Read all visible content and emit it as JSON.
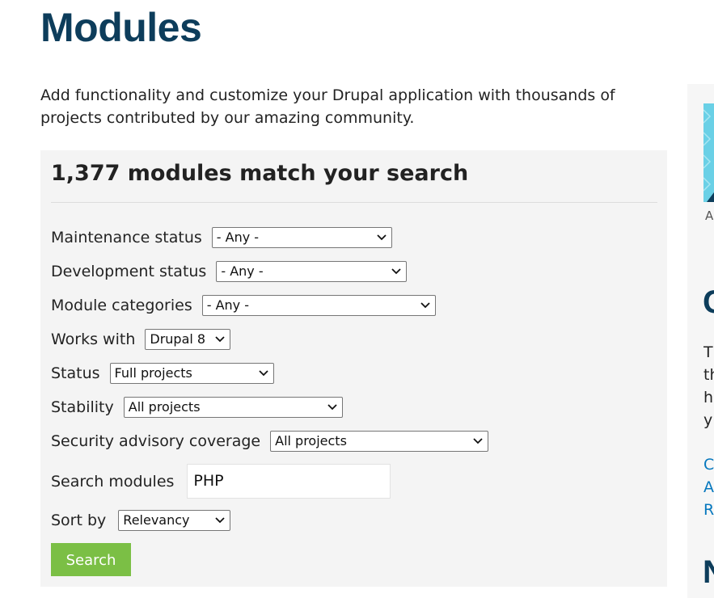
{
  "page": {
    "title": "Modules",
    "intro": "Add functionality and customize your Drupal application with thousands of projects contributed by our amazing community."
  },
  "search_panel": {
    "heading": "1,377 modules match your search",
    "filters": {
      "maintenance_status": {
        "label": "Maintenance status",
        "value": "- Any -"
      },
      "development_status": {
        "label": "Development status",
        "value": "- Any -"
      },
      "module_categories": {
        "label": "Module categories",
        "value": "- Any -"
      },
      "works_with": {
        "label": "Works with",
        "value": "Drupal 8"
      },
      "status": {
        "label": "Status",
        "value": "Full projects"
      },
      "stability": {
        "label": "Stability",
        "value": "All projects"
      },
      "security_advisory": {
        "label": "Security advisory coverage",
        "value": "All projects"
      },
      "search_modules": {
        "label": "Search modules",
        "value": "PHP"
      },
      "sort_by": {
        "label": "Sort by",
        "value": "Relevancy"
      }
    },
    "search_button": "Search"
  },
  "sidebar": {
    "ad_caption": "A",
    "heading_1": "C",
    "text_lines": [
      "T",
      "th",
      "h",
      "y"
    ],
    "links": [
      "C",
      "A",
      "R"
    ],
    "heading_2": "N"
  },
  "colors": {
    "title": "#0d3d5b",
    "panel_background": "#f4f4f4",
    "button": "#7bbf45",
    "link": "#0678be"
  },
  "icons": {
    "select_arrow": "chevron-down-icon"
  }
}
